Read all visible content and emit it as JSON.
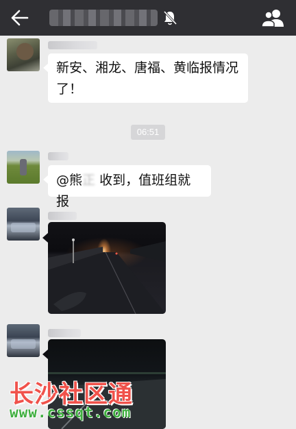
{
  "header": {
    "back_icon": "arrow-left-icon",
    "mute_icon": "bell-muted-icon",
    "members_icon": "group-members-icon"
  },
  "messages": [
    {
      "type": "text",
      "text_line1": "新安、湘龙、唐福、黄临报情况",
      "text_line2": "了！"
    },
    {
      "type": "time",
      "text": "06:51"
    },
    {
      "type": "text",
      "mention": "@熊",
      "mention_blur": "正",
      "text": " 收到，值班组就报"
    },
    {
      "type": "image",
      "description_icon": "night-road-photo"
    },
    {
      "type": "image",
      "description_icon": "night-road-photo"
    }
  ],
  "watermark": {
    "brand": "长沙社区通",
    "url": "www.cssqt.com"
  },
  "colors": {
    "header_bg": "#2f2f33",
    "chat_bg": "#ececec",
    "bubble_bg": "#ffffff",
    "watermark_red": "#f0524b",
    "watermark_green": "#3fae3f"
  }
}
